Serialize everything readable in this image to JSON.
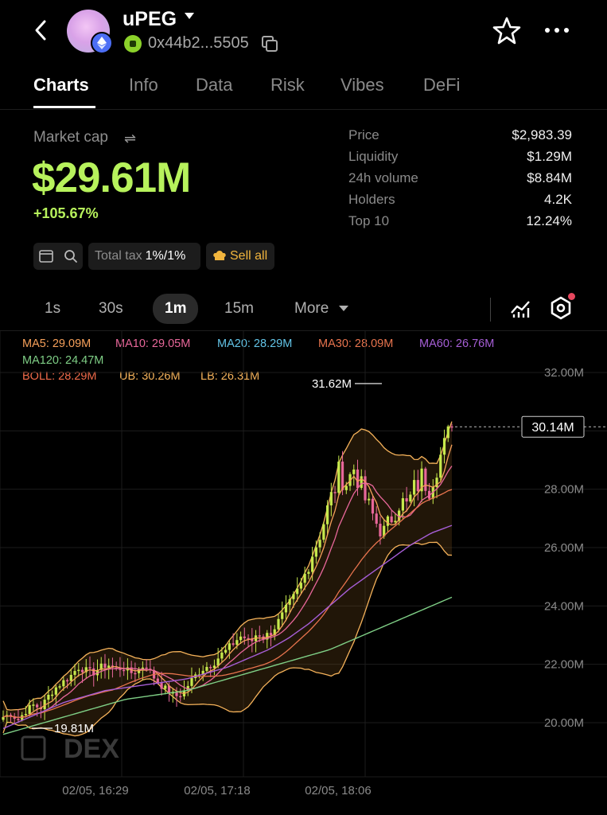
{
  "header": {
    "token_name": "uPEG",
    "address": "0x44b2...5505"
  },
  "tabs": [
    "Charts",
    "Info",
    "Data",
    "Risk",
    "Vibes",
    "DeFi"
  ],
  "market": {
    "label": "Market cap",
    "value": "$29.61M",
    "change": "+105.67%"
  },
  "stats": [
    {
      "label": "Price",
      "value": "$2,983.39"
    },
    {
      "label": "Liquidity",
      "value": "$1.29M"
    },
    {
      "label": "24h volume",
      "value": "$8.84M"
    },
    {
      "label": "Holders",
      "value": "4.2K"
    },
    {
      "label": "Top 10",
      "value": "12.24%"
    }
  ],
  "chips": {
    "tax_label": "Total tax",
    "tax_value": "1%/1%",
    "sell_all": "Sell all"
  },
  "intervals": [
    "1s",
    "30s",
    "1m",
    "15m"
  ],
  "intervals_more": "More",
  "active_interval": "1m",
  "indicators": {
    "ma5": "MA5: 29.09M",
    "ma10": "MA10: 29.05M",
    "ma20": "MA20: 28.29M",
    "ma30": "MA30: 28.09M",
    "ma60": "MA60: 26.76M",
    "ma120": "MA120: 24.47M",
    "boll": "BOLL: 28.29M",
    "ub": "UB: 30.26M",
    "lb": "LB: 26.31M"
  },
  "colors": {
    "accent_green": "#b7f25c",
    "up": "#c7e94d",
    "down": "#e8679a",
    "ma5": "#f6a05a",
    "ma10": "#e8679a",
    "ma20": "#62c3e6",
    "ma30": "#e8744e",
    "ma60": "#a65ed6",
    "ma120": "#7fcf86",
    "boll": "#f26b4a",
    "ub": "#f5b25a",
    "lb": "#f5b25a"
  },
  "chart_data": {
    "type": "candlestick",
    "y_ticks": [
      "32.00M",
      "30.00M",
      "28.00M",
      "26.00M",
      "24.00M",
      "22.00M",
      "20.00M"
    ],
    "ylim": [
      19.0,
      33.0
    ],
    "x_ticks": [
      "02/05, 16:29",
      "02/05, 17:18",
      "02/05, 18:06"
    ],
    "high_label": "31.62M",
    "high_value": 31.62,
    "low_label": "19.81M",
    "low_value": 19.81,
    "current_label": "30.14M",
    "current_value": 30.14,
    "watermark": "DEX",
    "price_path": [
      20.2,
      20.3,
      20.1,
      20.4,
      20.6,
      20.5,
      20.9,
      21.2,
      21.4,
      21.6,
      21.9,
      21.8,
      21.7,
      21.9,
      22.0,
      21.8,
      21.9,
      21.7,
      21.8,
      22.0,
      21.6,
      21.3,
      21.1,
      20.9,
      21.0,
      21.4,
      21.7,
      21.9,
      22.0,
      22.3,
      22.5,
      22.8,
      23.0,
      22.7,
      23.1,
      22.9,
      23.2,
      23.5,
      23.9,
      24.3,
      24.8,
      25.6,
      26.2,
      27.0,
      27.8,
      28.6,
      28.2,
      28.8,
      27.9,
      27.3,
      26.8,
      26.5,
      27.1,
      27.6,
      27.4,
      28.0,
      28.4,
      28.1,
      28.9,
      29.4,
      30.14
    ],
    "ma120_path": [
      19.6,
      19.8,
      20.0,
      20.2,
      20.4,
      20.6,
      20.8,
      20.9,
      21.0,
      21.1,
      21.3,
      21.5,
      21.7,
      21.9,
      22.1,
      22.3,
      22.5,
      22.8,
      23.1,
      23.4,
      23.7,
      24.0,
      24.3
    ],
    "ma60_path": [
      19.8,
      20.1,
      20.4,
      20.7,
      20.9,
      21.1,
      21.2,
      21.3,
      21.4,
      21.5,
      21.7,
      21.9,
      22.2,
      22.5,
      22.9,
      23.4,
      24.0,
      24.6,
      25.1,
      25.6,
      26.1,
      26.5,
      26.76
    ]
  }
}
